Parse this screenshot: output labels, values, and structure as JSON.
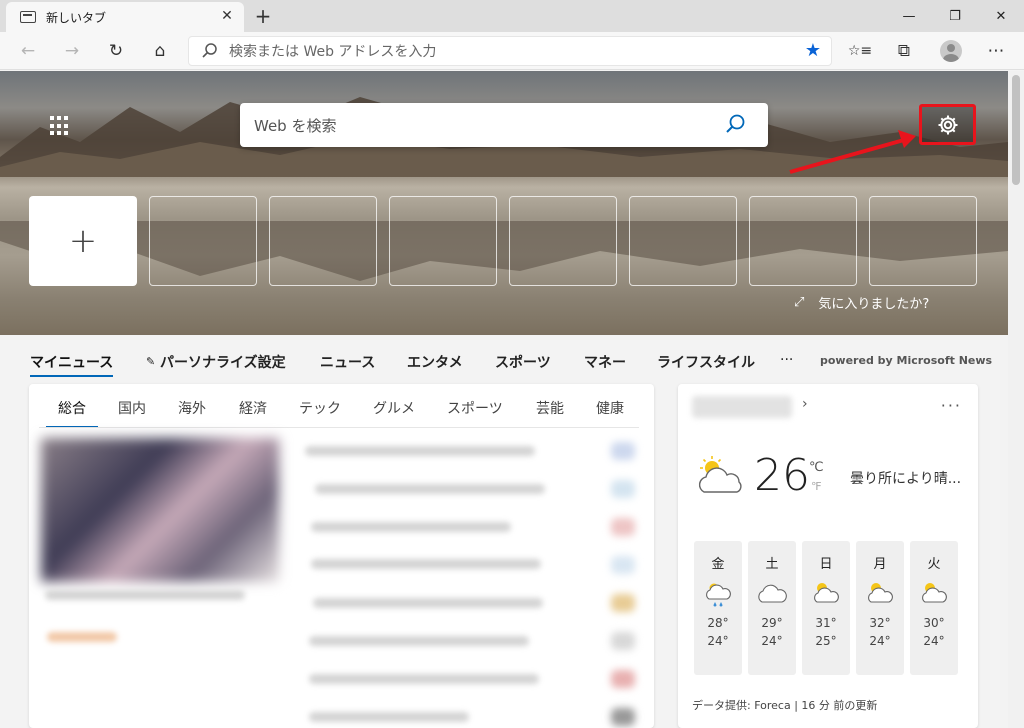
{
  "tab": {
    "title": "新しいタブ",
    "close": "✕",
    "new": "+"
  },
  "window": {
    "minimize": "—",
    "restore": "❐",
    "close": "✕"
  },
  "toolbar": {
    "back": "←",
    "forward": "→",
    "refresh": "↻",
    "home": "⌂",
    "address_placeholder": "検索または Web アドレスを入力",
    "favorites_star": "★",
    "favorites_list": "☆≡",
    "collections": "⧉",
    "more": "⋯"
  },
  "hero": {
    "search_placeholder": "Web を検索",
    "like_prompt": "気に入りましたか?",
    "expand_icon": "⤢",
    "add_tile": "+"
  },
  "news_nav": {
    "items": [
      "マイニュース",
      "パーソナライズ設定",
      "ニュース",
      "エンタメ",
      "スポーツ",
      "マネー",
      "ライフスタイル",
      "···"
    ],
    "powered": "powered by Microsoft News"
  },
  "news_categories": [
    "総合",
    "国内",
    "海外",
    "経済",
    "テック",
    "グルメ",
    "スポーツ",
    "芸能",
    "健康"
  ],
  "weather": {
    "temp": "26",
    "unit_c": "℃",
    "unit_f": "℉",
    "description": "曇り所により晴...",
    "more": "···",
    "chevron": "›",
    "days": [
      {
        "name": "金",
        "high": "28°",
        "low": "24°",
        "icon": "rain-sun-icon"
      },
      {
        "name": "土",
        "high": "29°",
        "low": "24°",
        "icon": "cloud-icon"
      },
      {
        "name": "日",
        "high": "31°",
        "low": "25°",
        "icon": "partly-sunny-icon"
      },
      {
        "name": "月",
        "high": "32°",
        "low": "24°",
        "icon": "partly-sunny-icon"
      },
      {
        "name": "火",
        "high": "30°",
        "low": "24°",
        "icon": "partly-sunny-icon"
      }
    ],
    "footer": "データ提供: Foreca | 16 分 前の更新"
  },
  "colors": {
    "accent": "#0067b8",
    "highlight": "#e8141c",
    "star": "#0a63d6"
  }
}
